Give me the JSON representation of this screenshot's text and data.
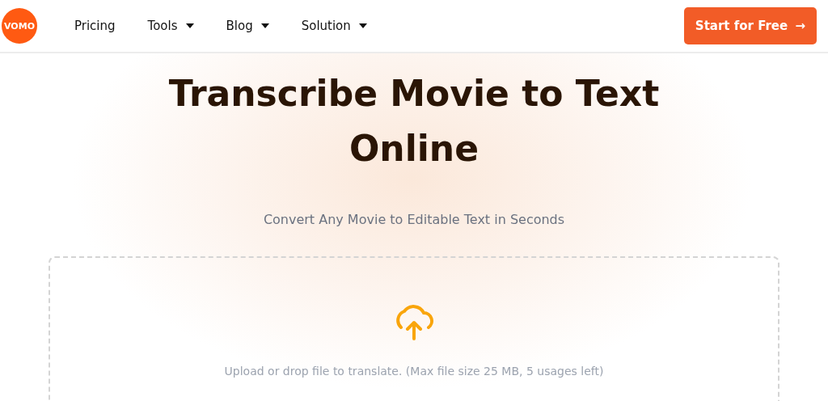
{
  "logo": "VOMO",
  "nav": [
    {
      "label": "Pricing",
      "dropdown": false
    },
    {
      "label": "Tools",
      "dropdown": true
    },
    {
      "label": "Blog",
      "dropdown": true
    },
    {
      "label": "Solution",
      "dropdown": true
    }
  ],
  "cta": {
    "label": "Start for Free",
    "arrow": "→"
  },
  "title": "Transcribe Movie to Text Online",
  "subtitle": "Convert Any Movie to Editable Text in Seconds",
  "upload": {
    "hint": "Upload or drop file to translate. (Max file size 25 MB, 5 usages left)"
  }
}
